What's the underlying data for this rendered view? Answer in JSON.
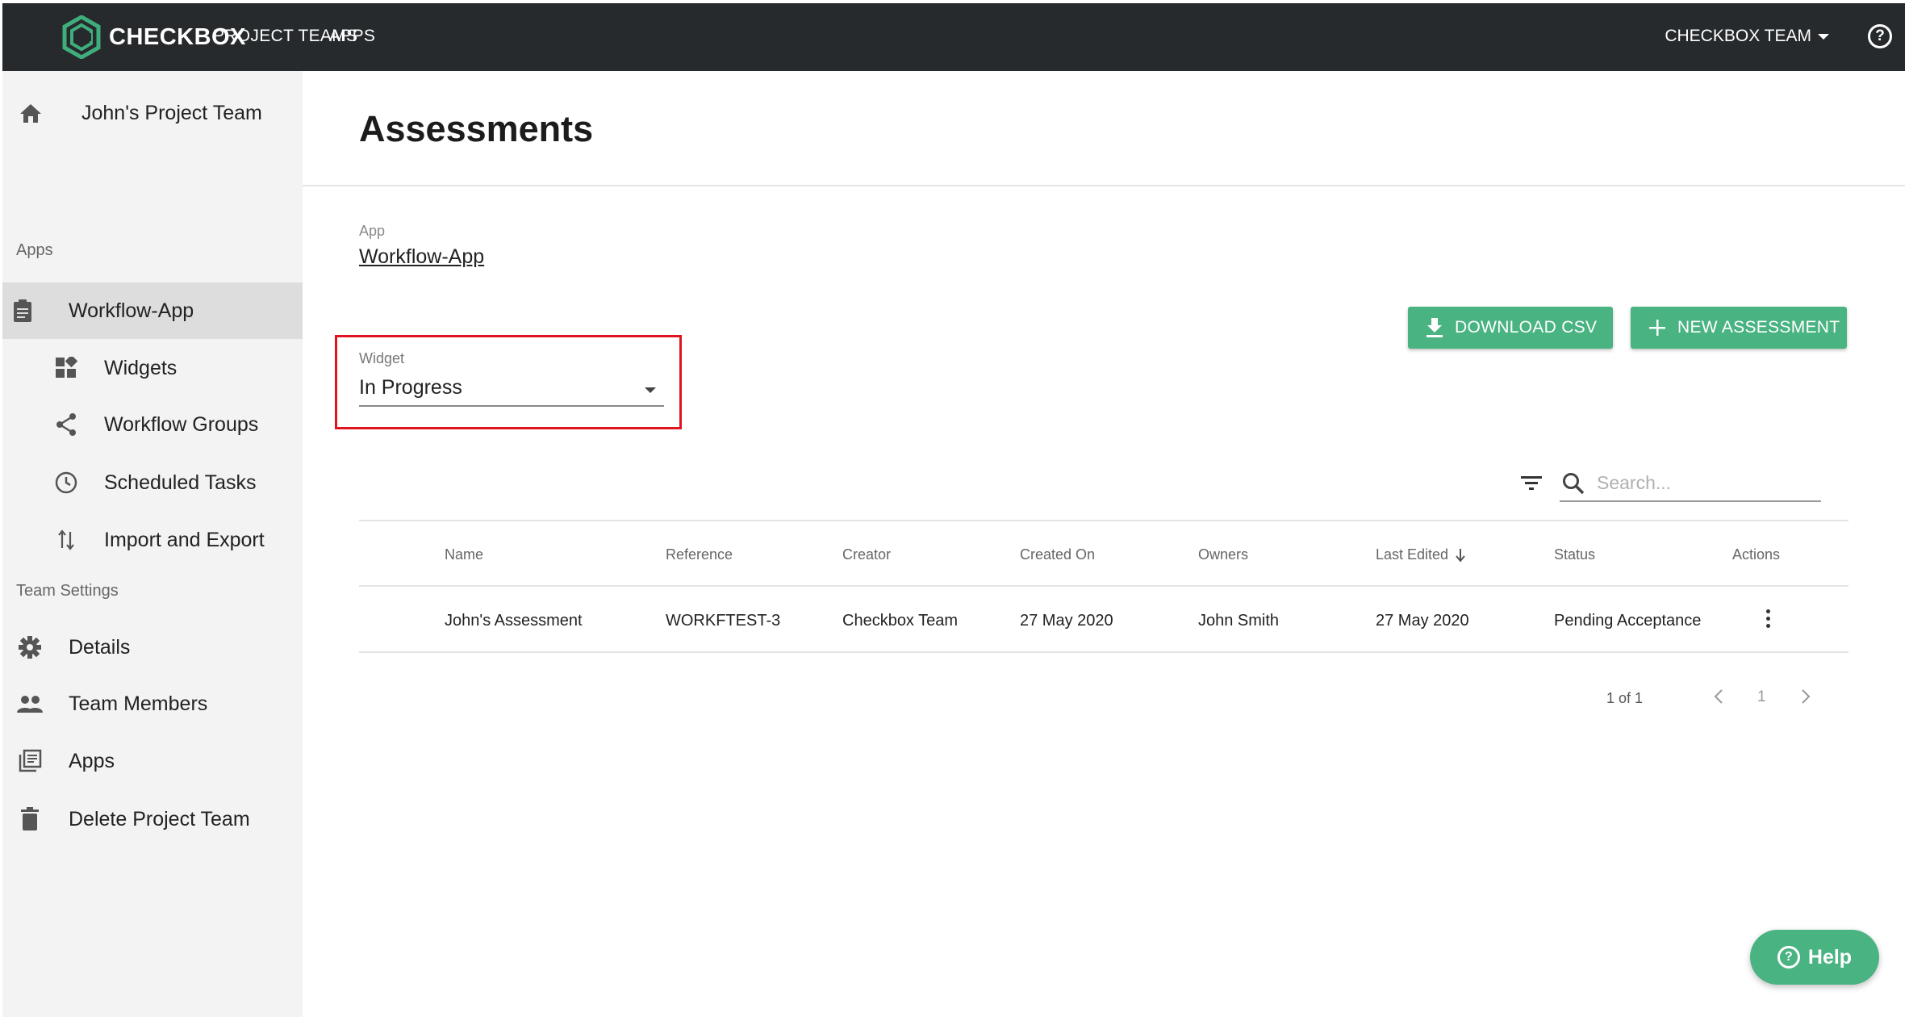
{
  "topbar": {
    "brand": "CHECKBOX",
    "nav": [
      "PROJECT TEAMS",
      "APPS"
    ],
    "team_menu": "CHECKBOX TEAM",
    "help_icon": "question-circle-icon"
  },
  "sidebar": {
    "team_name": "John's Project Team",
    "apps_section": "Apps",
    "app_item": "Workflow-App",
    "app_subitems": [
      "Widgets",
      "Workflow Groups",
      "Scheduled Tasks",
      "Import and Export"
    ],
    "settings_section": "Team Settings",
    "settings_items": [
      "Details",
      "Team Members",
      "Apps",
      "Delete Project Team"
    ]
  },
  "main": {
    "title": "Assessments",
    "app_caption": "App",
    "app_value": "Workflow-App",
    "widget_caption": "Widget",
    "widget_value": "In Progress",
    "download_label": "DOWNLOAD CSV",
    "new_label": "NEW ASSESSMENT",
    "search_placeholder": "Search..."
  },
  "table": {
    "columns": [
      "Name",
      "Reference",
      "Creator",
      "Created On",
      "Owners",
      "Last Edited",
      "Status",
      "Actions"
    ],
    "rows": [
      {
        "name": "John's Assessment",
        "reference": "WORKFTEST-3",
        "creator": "Checkbox Team",
        "created_on": "27 May 2020",
        "owners": "John Smith",
        "last_edited": "27 May 2020",
        "status": "Pending Acceptance"
      }
    ]
  },
  "pagination": {
    "summary": "1 of 1",
    "current_page": "1"
  },
  "help_button": "Help",
  "colors": {
    "topbar": "#262a2d",
    "accent_green": "#49b382",
    "sidebar_bg": "#f3f3f3",
    "sidebar_active": "#dddddd",
    "highlight_red": "#e0141e"
  }
}
